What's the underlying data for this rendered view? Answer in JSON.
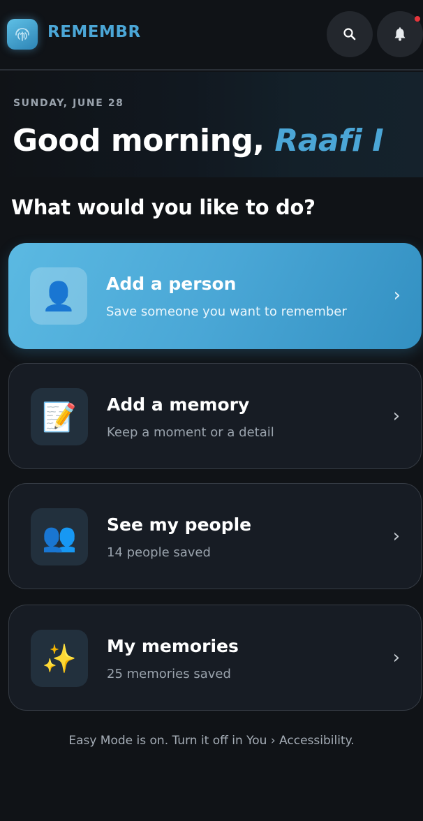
{
  "app": {
    "brand": "REMEMBR",
    "logo_icon": "fingerprint-icon",
    "accent_color": "#4ba6d6",
    "notification_dot_color": "#e5353b"
  },
  "header": {
    "search_icon": "search-icon",
    "bell_icon": "bell-icon"
  },
  "hero": {
    "date": "SUNDAY, JUNE 28",
    "greeting": "Good morning, ",
    "name": "Raafi I"
  },
  "prompt": "What would you like to do?",
  "actions": [
    {
      "title": "Add a person",
      "subtitle": "Save someone you want to remember",
      "icon": "👤",
      "icon_name": "person-icon"
    },
    {
      "title": "Add a memory",
      "subtitle": "Keep a moment or a detail",
      "icon": "📝",
      "icon_name": "memo-icon"
    },
    {
      "title": "See my people",
      "subtitle": "14 people saved",
      "icon": "👥",
      "icon_name": "people-icon"
    },
    {
      "title": "My memories",
      "subtitle": "25 memories saved",
      "icon": "✨",
      "icon_name": "sparkles-icon"
    }
  ],
  "chevron": "›",
  "footer": "Easy Mode is on. Turn it off in You › Accessibility."
}
